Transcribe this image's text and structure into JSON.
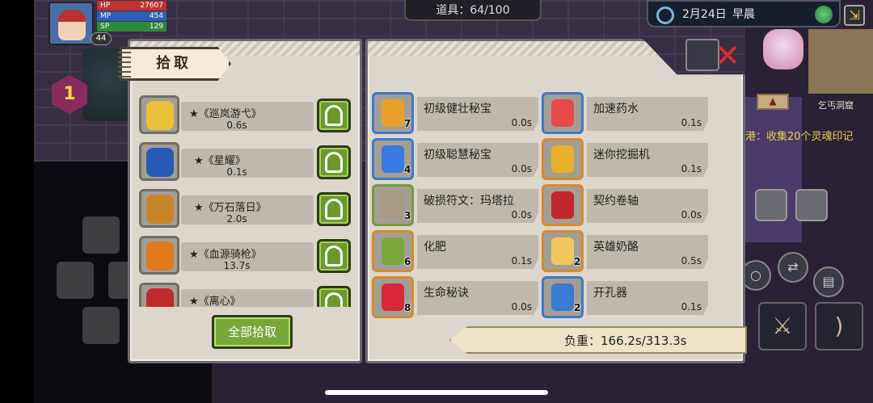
{
  "hud": {
    "hp_label": "HP",
    "hp_value": "27607",
    "mp_label": "MP",
    "mp_value": "454",
    "sp_label": "SP",
    "sp_value": "129",
    "player_level": "44",
    "floor_level": "1",
    "items_counter": "道具：64/100",
    "date": "2月24日",
    "time_of_day": "早晨",
    "minimap_label": "乞丐洞窟",
    "quest_text": "港：收集20个灵魂印记"
  },
  "loot_panel": {
    "title": "拾取",
    "pickup_all_label": "全部拾取",
    "items": [
      {
        "name": "★《巡岚游弋》",
        "time": "0.6s",
        "icon": "ring-icon",
        "color": "#e8c23a"
      },
      {
        "name": "★《星耀》",
        "time": "0.1s",
        "icon": "armor-icon",
        "color": "#2a5ab8"
      },
      {
        "name": "★《万石落日》",
        "time": "2.0s",
        "icon": "bow-icon",
        "color": "#c8862a"
      },
      {
        "name": "★《血源骑枪》",
        "time": "13.7s",
        "icon": "orb-icon",
        "color": "#e07a1a"
      },
      {
        "name": "★《离心》",
        "time": "",
        "icon": "blade-icon",
        "color": "#c02a2a"
      }
    ]
  },
  "inventory": {
    "items": [
      {
        "name": "初级健壮秘宝",
        "time": "0.0s",
        "count": "7",
        "icon": "amber-gem-icon",
        "color": "#e8a02a",
        "border": "blue"
      },
      {
        "name": "加速药水",
        "time": "0.1s",
        "count": "",
        "icon": "potion-icon",
        "color": "#e84a4a",
        "border": "blue"
      },
      {
        "name": "初级聪慧秘宝",
        "time": "0.0s",
        "count": "4",
        "icon": "sapphire-gem-icon",
        "color": "#3a7ae0",
        "border": "blue"
      },
      {
        "name": "迷你挖掘机",
        "time": "0.1s",
        "count": "",
        "icon": "excavator-icon",
        "color": "#e8b02a",
        "border": "orange"
      },
      {
        "name": "破损符文：玛塔拉",
        "time": "0.0s",
        "count": "3",
        "icon": "rune-icon",
        "color": "#a89a82",
        "border": "green"
      },
      {
        "name": "契约卷轴",
        "time": "0.0s",
        "count": "",
        "icon": "scroll-icon",
        "color": "#c0282a",
        "border": "orange"
      },
      {
        "name": "化肥",
        "time": "0.1s",
        "count": "6",
        "icon": "fertilizer-icon",
        "color": "#7aa83a",
        "border": "orange"
      },
      {
        "name": "英雄奶酪",
        "time": "0.5s",
        "count": "2",
        "icon": "cheese-icon",
        "color": "#f0c860",
        "border": "orange"
      },
      {
        "name": "生命秘诀",
        "time": "0.0s",
        "count": "8",
        "icon": "heart-gem-icon",
        "color": "#d8283a",
        "border": "orange"
      },
      {
        "name": "开孔器",
        "time": "0.1s",
        "count": "2",
        "icon": "drill-icon",
        "color": "#3a7ad0",
        "border": "blue"
      }
    ],
    "weight_text": "负重：166.2s/313.3s"
  }
}
